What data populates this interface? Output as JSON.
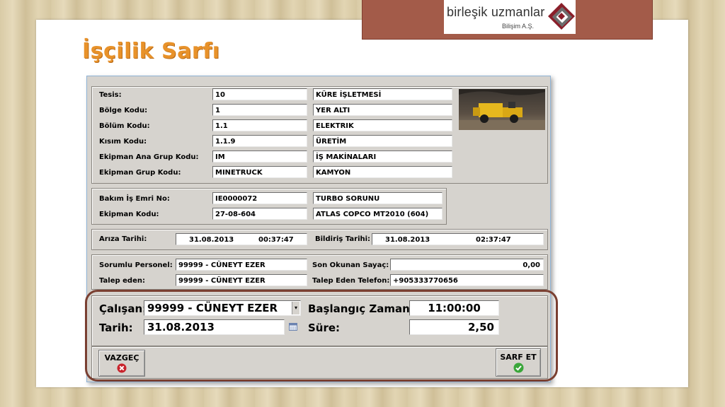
{
  "page_title": "İşçilik Sarfı",
  "logo": {
    "name": "birleşik uzmanlar",
    "subtitle": "Bilişim A.Ş."
  },
  "header": {
    "rows": [
      {
        "label": "Tesis:",
        "code": "10",
        "desc": "KÜRE İŞLETMESİ"
      },
      {
        "label": "Bölge Kodu:",
        "code": "1",
        "desc": "YER ALTI"
      },
      {
        "label": "Bölüm Kodu:",
        "code": "1.1",
        "desc": "ELEKTRIK"
      },
      {
        "label": "Kısım Kodu:",
        "code": "1.1.9",
        "desc": "ÜRETİM"
      },
      {
        "label": "Ekipman Ana Grup Kodu:",
        "code": "IM",
        "desc": "İŞ MAKİNALARI"
      },
      {
        "label": "Ekipman Grup Kodu:",
        "code": "MINETRUCK",
        "desc": "KAMYON"
      }
    ]
  },
  "work_order": {
    "order_label": "Bakım İş Emri No:",
    "order_no": "IE0000072",
    "order_desc": "TURBO SORUNU",
    "equip_label": "Ekipman Kodu:",
    "equip_code": "27-08-604",
    "equip_desc": "ATLAS COPCO MT2010 (604)"
  },
  "dates": {
    "fault_label": "Arıza Tarihi:",
    "fault_date": "31.08.2013",
    "fault_time": "00:37:47",
    "notice_label": "Bildiriş Tarihi:",
    "notice_date": "31.08.2013",
    "notice_time": "02:37:47"
  },
  "personnel": {
    "responsible_label": "Sorumlu Personel:",
    "responsible": "99999 - CÜNEYT EZER",
    "counter_label": "Son Okunan Sayaç:",
    "counter": "0,00",
    "requester_label": "Talep eden:",
    "requester": "99999 - CÜNEYT EZER",
    "phone_label": "Talep Eden Telefon:",
    "phone": "+905333770656"
  },
  "labor": {
    "employee_label": "Çalışan:",
    "employee": "99999 - CÜNEYT EZER",
    "start_label": "Başlangıç Zamanı:",
    "start": "11:00:00",
    "date_label": "Tarih:",
    "date": "31.08.2013",
    "duration_label": "Süre:",
    "duration": "2,50"
  },
  "buttons": {
    "cancel": "VAZGEÇ",
    "submit": "SARF ET"
  },
  "colors": {
    "accent_title": "#e8922a",
    "banner": "#a35b49",
    "frame": "#7a3f31",
    "window": "#d6d3ce"
  }
}
